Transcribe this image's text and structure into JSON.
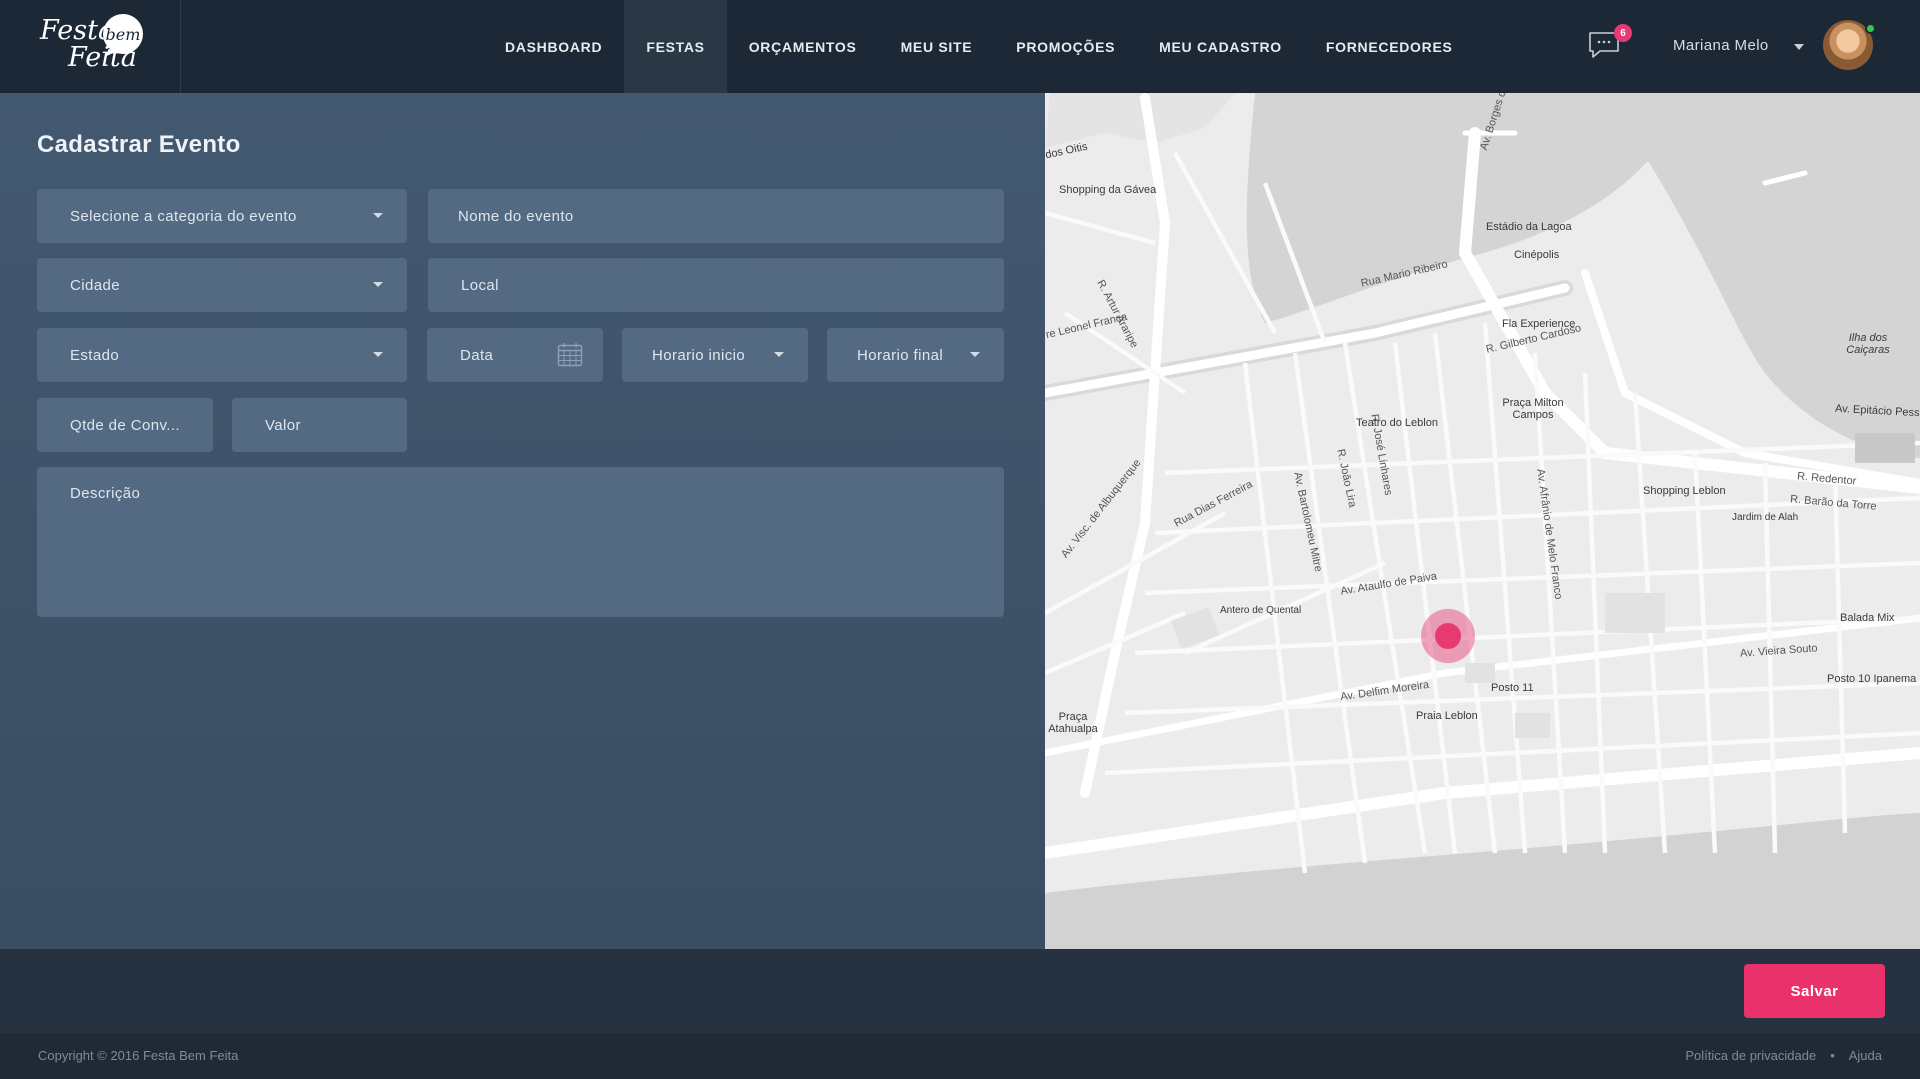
{
  "brand": {
    "line1": "Festa",
    "line2": "Feita",
    "bubble": "bem"
  },
  "nav": {
    "items": [
      {
        "label": "DASHBOARD"
      },
      {
        "label": "FESTAS"
      },
      {
        "label": "ORÇAMENTOS"
      },
      {
        "label": "MEU SITE"
      },
      {
        "label": "PROMOÇÕES"
      },
      {
        "label": "MEU CADASTRO"
      },
      {
        "label": "FORNECEDORES"
      }
    ],
    "active": "FESTAS"
  },
  "header": {
    "messages_count": "6",
    "user_name": "Mariana Melo"
  },
  "form": {
    "title": "Cadastrar Evento",
    "categoria": "Selecione a categoria do evento",
    "nome": "Nome do evento",
    "cidade": "Cidade",
    "local": "Local",
    "estado": "Estado",
    "data": "Data",
    "horario_inicio": "Horario inicio",
    "horario_final": "Horario final",
    "qtde": "Qtde de Conv...",
    "valor": "Valor",
    "descricao": "Descrição"
  },
  "map": {
    "labels": {
      "shopping_gavea": "Shopping da Gávea",
      "estadio_lagoa": "Estádio da Lagoa",
      "cinepolis": "Cinépolis",
      "rua_mario_ribeiro": "Rua Mario Ribeiro",
      "fla_experience": "Fla Experience",
      "leonel_franca": "re Leonel Franca",
      "gilberto_cardoso": "R. Gilberto Cardoso",
      "ilha_caicaras": "Ilha dos Caiçaras",
      "teatro_leblon": "Teatro do Leblon",
      "praca_milton": "Praça Milton Campos",
      "epitacio": "Av. Epitácio Pess",
      "shopping_leblon": "Shopping Leblon",
      "redentor": "R. Redentor",
      "barao_torre": "R. Barão da Torre",
      "jardim_alah": "Jardim de Alah",
      "ataulfo_paiva": "Av. Ataulfo de Paiva",
      "antero_quental": "Antero de Quental",
      "balada_mix": "Balada Mix",
      "vieira_souto": "Av. Vieira Souto",
      "posto_10": "Posto 10 Ipanema",
      "posto_11": "Posto 11",
      "delfim_moreira": "Av. Delfim Moreira",
      "praia_leblon": "Praia Leblon",
      "praca_atahualpa": "Praça Atahualpa",
      "borges_medeiros": "Av. Borges de Medeiros",
      "dos_oitis": "dos Oitis",
      "artur_araripe": "R. Artur Araripe",
      "visc_albuquerque": "Av. Visc. de Albuquerque",
      "dias_ferreira": "Rua Dias Ferreira",
      "bartolomeu_mitre": "Av. Bartolomeu Mitre",
      "joao_lira": "R. João Lira",
      "jose_linhares": "R. José Linhares",
      "afranio_melo_franco": "Av. Afrânio de Melo Franco"
    }
  },
  "actions": {
    "save_label": "Salvar"
  },
  "footer": {
    "copyright": "Copyright © 2016 Festa Bem Feita",
    "privacy": "Política de privacidade",
    "separator": "•",
    "help": "Ajuda"
  },
  "colors": {
    "accent": "#e9326c",
    "header_bg": "#1c2835",
    "panel_bg": "#435970",
    "field_bg": "#546a82"
  }
}
